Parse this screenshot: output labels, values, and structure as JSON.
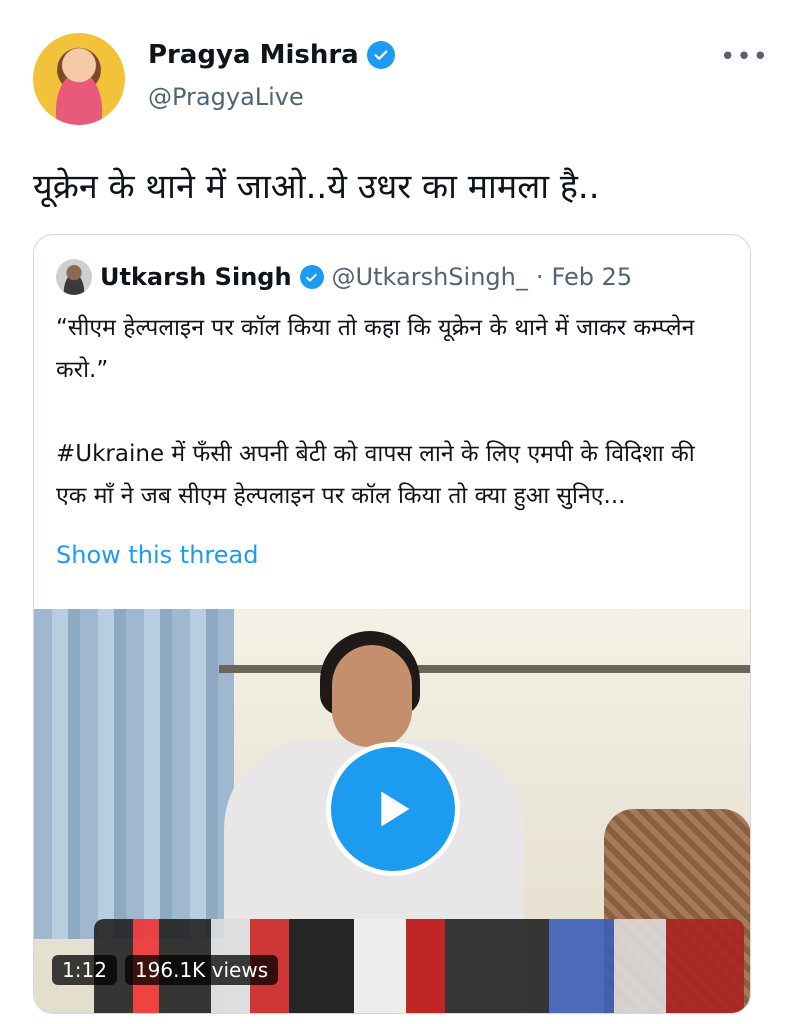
{
  "author": {
    "name": "Pragya Mishra",
    "handle": "@PragyaLive",
    "avatar_icon": "profile-photo"
  },
  "tweet": {
    "text": "यूक्रेन के थाने में जाओ..ये उधर का मामला है.."
  },
  "more_icon": "•••",
  "quoted_tweet": {
    "name": "Utkarsh Singh",
    "handle": "@UtkarshSingh_",
    "dot": "·",
    "date": "Feb 25",
    "paragraph1": "“सीएम हेल्पलाइन पर कॉल किया तो कहा कि यूक्रेन के थाने में जाकर कम्प्लेन करो.”",
    "paragraph2": "#Ukraine में फँसी अपनी बेटी को वापस लाने के लिए एमपी के विदिशा की एक माँ ने जब सीएम हेल्पलाइन पर कॉल किया तो क्या हुआ सुनिए...",
    "show_thread": "Show this thread"
  },
  "video": {
    "duration": "1:12",
    "views": "196.1K views"
  },
  "colors": {
    "accent": "#1d9bf0",
    "secondary_text": "#536471",
    "border": "#cfd9de"
  }
}
